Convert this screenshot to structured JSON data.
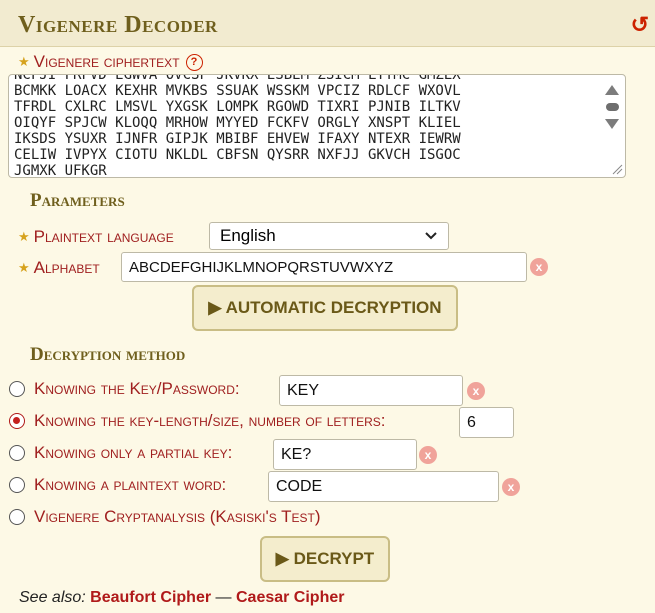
{
  "header": {
    "title": "Vigenere Decoder"
  },
  "ciphertext": {
    "label": "Vigenere ciphertext",
    "help": "?",
    "lines": [
      "NCFJI FRFVD EGWVA OVCSF JKVKX ESBEM ZSICM LTTMC GMZEX",
      "BCMKK LOACX KEXHR MVKBS SSUAK WSSKM VPCIZ RDLCF WXOVL",
      "TFRDL CXLRC LMSVL YXGSK LOMPK RGOWD TIXRI PJNIB ILTKV",
      "OIQYF SPJCW KLOQQ MRHOW MYYED FCKFV ORGLY XNSPT KLIEL",
      "IKSDS YSUXR IJNFR GIPJK MBIBF EHVEW IFAXY NTEXR IEWRW",
      "CELIW IVPYX CIOTU NKLDL CBFSN QYSRR NXFJJ GKVCH ISGOC",
      "JGMXK UFKGR"
    ]
  },
  "parameters": {
    "heading": "Parameters",
    "language_label": "Plaintext language",
    "language_value": "English",
    "alphabet_label": "Alphabet",
    "alphabet_value": "ABCDEFGHIJKLMNOPQRSTUVWXYZ",
    "auto_button": "▶ AUTOMATIC DECRYPTION"
  },
  "method": {
    "heading": "Decryption method",
    "options": [
      {
        "label": "Knowing the Key/Password:",
        "value": "KEY",
        "selected": false
      },
      {
        "label": "Knowing the key-length/size, number of letters:",
        "value": "6",
        "selected": true
      },
      {
        "label": "Knowing only a partial key:",
        "value": "KE?",
        "selected": false
      },
      {
        "label": "Knowing a plaintext word:",
        "value": "CODE",
        "selected": false
      },
      {
        "label": "Vigenere Cryptanalysis (Kasiski's Test)",
        "selected": false
      }
    ],
    "decrypt_button": "▶ DECRYPT"
  },
  "footer": {
    "prefix": "See also:",
    "link1": "Beaufort Cipher",
    "sep": "—",
    "link2": "Caesar Cipher"
  },
  "colors": {
    "accent_red": "#a02020",
    "heading_brown": "#6f5f1d",
    "background": "#fdf9e6"
  }
}
